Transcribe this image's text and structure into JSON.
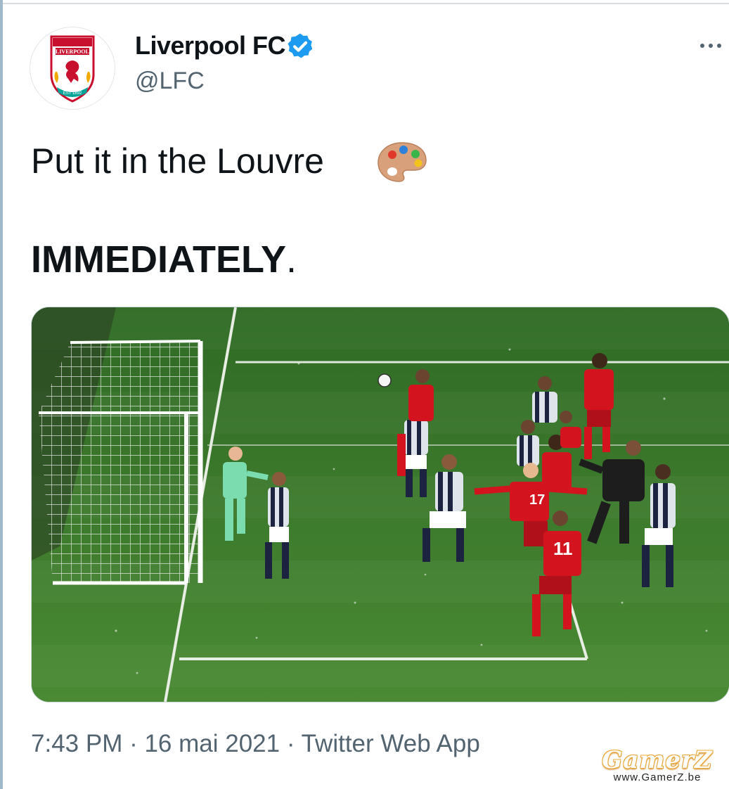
{
  "author": {
    "display_name": "Liverpool FC",
    "handle": "@LFC",
    "verified": true,
    "avatar_icon": "liverpool-fc-crest"
  },
  "tweet": {
    "line1": "Put it in the Louvre",
    "emoji_icon": "artist-palette-icon",
    "line2_bold": "IMMEDIATELY",
    "line2_tail": "."
  },
  "media": {
    "description_icon": "football-match-photo",
    "shirt_numbers": [
      "17",
      "11"
    ]
  },
  "meta": {
    "time": "7:43 PM",
    "date": "16 mai 2021",
    "source": "Twitter Web App",
    "separator": " · "
  },
  "watermark": {
    "logo": "GamerZ",
    "url": "www.GamerZ.be"
  },
  "colors": {
    "verified_blue": "#1d9bf0",
    "text": "#0f1419",
    "muted": "#536471",
    "pitch": "#3e7a2e",
    "liverpool_red": "#d3131e"
  }
}
